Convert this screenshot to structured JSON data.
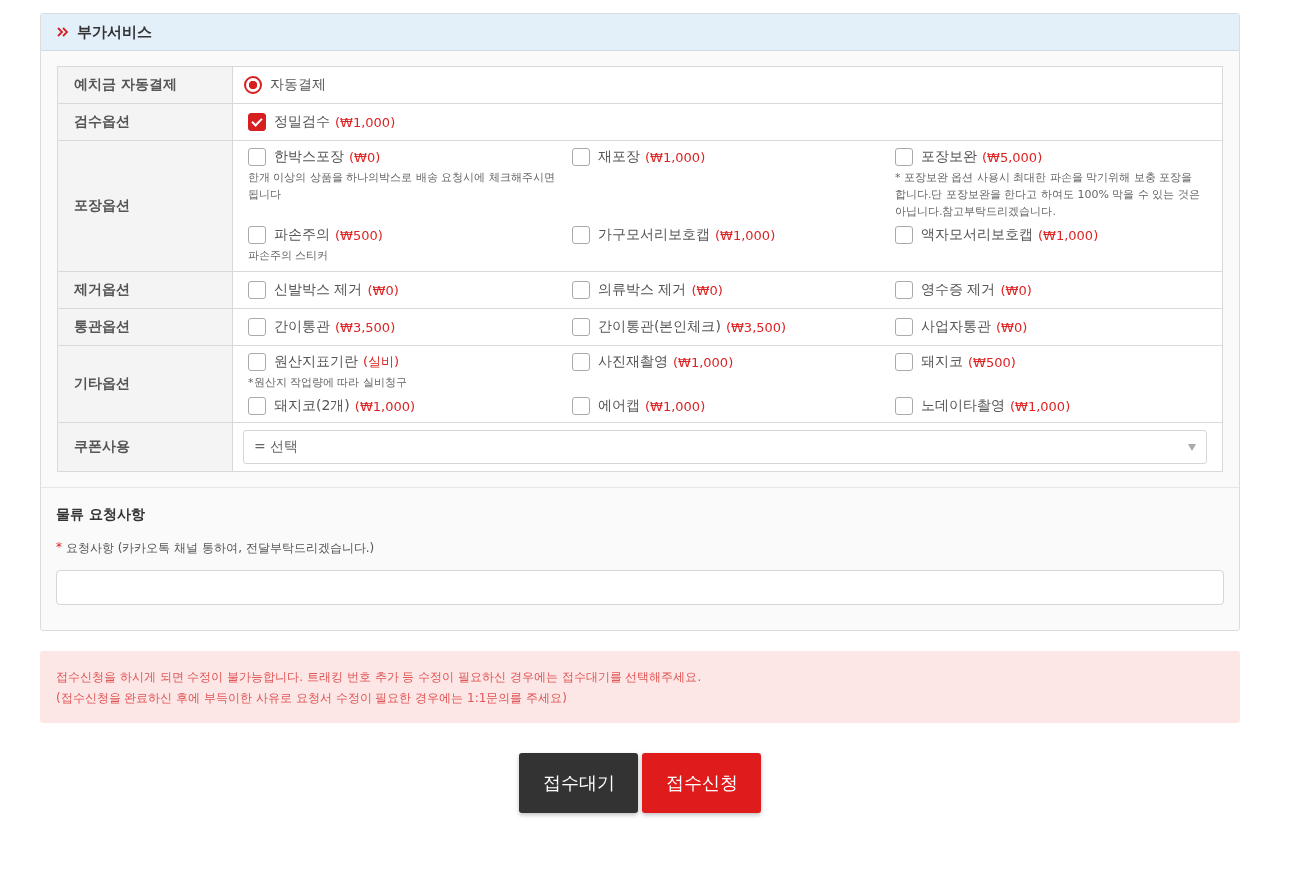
{
  "section": {
    "title": "부가서비스"
  },
  "rows": [
    {
      "label": "예치금 자동결제",
      "kind": "radio",
      "options": [
        {
          "label": "자동결제",
          "selected": true
        }
      ]
    },
    {
      "label": "검수옵션",
      "kind": "checks",
      "options": [
        {
          "label": "정밀검수",
          "price": "(₩1,000)",
          "checked": true
        }
      ]
    },
    {
      "label": "포장옵션",
      "kind": "checks",
      "options": [
        {
          "label": "한박스포장",
          "price": "(₩0)",
          "checked": false,
          "note": "한개 이상의 상품을 하나의박스로 배송 요청시에 체크해주시면 됩니다"
        },
        {
          "label": "재포장",
          "price": "(₩1,000)",
          "checked": false
        },
        {
          "label": "포장보완",
          "price": "(₩5,000)",
          "checked": false,
          "note": "* 포장보완 옵션 사용시 최대한 파손을 막기위해 보충 포장을 합니다.단 포장보완을 한다고 하여도 100% 막을 수 있는 것은 아닙니다.참고부탁드리겠습니다."
        },
        {
          "label": "파손주의",
          "price": "(₩500)",
          "checked": false,
          "note": "파손주의 스티커"
        },
        {
          "label": "가구모서리보호캡",
          "price": "(₩1,000)",
          "checked": false
        },
        {
          "label": "액자모서리보호캡",
          "price": "(₩1,000)",
          "checked": false
        }
      ]
    },
    {
      "label": "제거옵션",
      "kind": "checks",
      "options": [
        {
          "label": "신발박스 제거",
          "price": "(₩0)",
          "checked": false
        },
        {
          "label": "의류박스 제거",
          "price": "(₩0)",
          "checked": false
        },
        {
          "label": "영수증 제거",
          "price": "(₩0)",
          "checked": false
        }
      ]
    },
    {
      "label": "통관옵션",
      "kind": "checks",
      "options": [
        {
          "label": "간이통관",
          "price": "(₩3,500)",
          "checked": false
        },
        {
          "label": "간이통관(본인체크)",
          "price": "(₩3,500)",
          "checked": false
        },
        {
          "label": "사업자통관",
          "price": "(₩0)",
          "checked": false
        }
      ]
    },
    {
      "label": "기타옵션",
      "kind": "checks",
      "options": [
        {
          "label": "원산지표기란",
          "price": "(실비)",
          "checked": false,
          "note": "*원산지 작업량에 따라 실비청구"
        },
        {
          "label": "사진재촬영",
          "price": "(₩1,000)",
          "checked": false
        },
        {
          "label": "돼지코",
          "price": "(₩500)",
          "checked": false
        },
        {
          "label": "돼지코(2개)",
          "price": "(₩1,000)",
          "checked": false
        },
        {
          "label": "에어캡",
          "price": "(₩1,000)",
          "checked": false
        },
        {
          "label": "노데이타촬영",
          "price": "(₩1,000)",
          "checked": false
        }
      ]
    },
    {
      "label": "쿠폰사용",
      "kind": "select",
      "value": "= 선택"
    }
  ],
  "request": {
    "title": "물류 요청사항",
    "required_mark": "*",
    "label": "요청사항 (카카오톡 채널 통하여, 전달부탁드리겠습니다.)"
  },
  "notice": {
    "lines": [
      "접수신청을 하시게 되면 수정이 불가능합니다. 트래킹 번호 추가 등 수정이 필요하신 경우에는 접수대기를 선택해주세요.",
      "(접수신청을 완료하신 후에 부득이한 사유로 요청서 수정이 필요한 경우에는 1:1문의를 주세요)"
    ]
  },
  "buttons": [
    {
      "label": "접수대기",
      "kind": "secondary"
    },
    {
      "label": "접수신청",
      "kind": "primary"
    }
  ]
}
